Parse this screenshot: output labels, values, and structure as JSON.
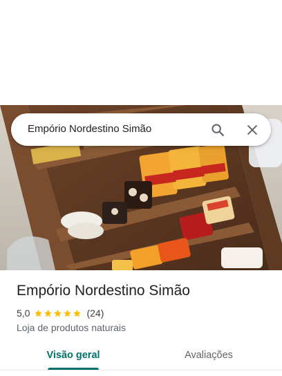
{
  "search": {
    "query": "Empório Nordestino Simão",
    "search_icon": "search-icon",
    "close_icon": "close-icon"
  },
  "place": {
    "name": "Empório Nordestino Simão",
    "rating": "5,0",
    "stars_filled": 5,
    "stars_total": 5,
    "review_count": "(24)",
    "category": "Loja de produtos naturais",
    "photo_description_icon": "store-photo"
  },
  "tabs": [
    {
      "label": "Visão geral",
      "active": true
    },
    {
      "label": "Avaliações",
      "active": false
    }
  ],
  "colors": {
    "accent": "#01706b",
    "star": "#fbbc04",
    "text_primary": "#202124",
    "text_secondary": "#5f6368"
  }
}
